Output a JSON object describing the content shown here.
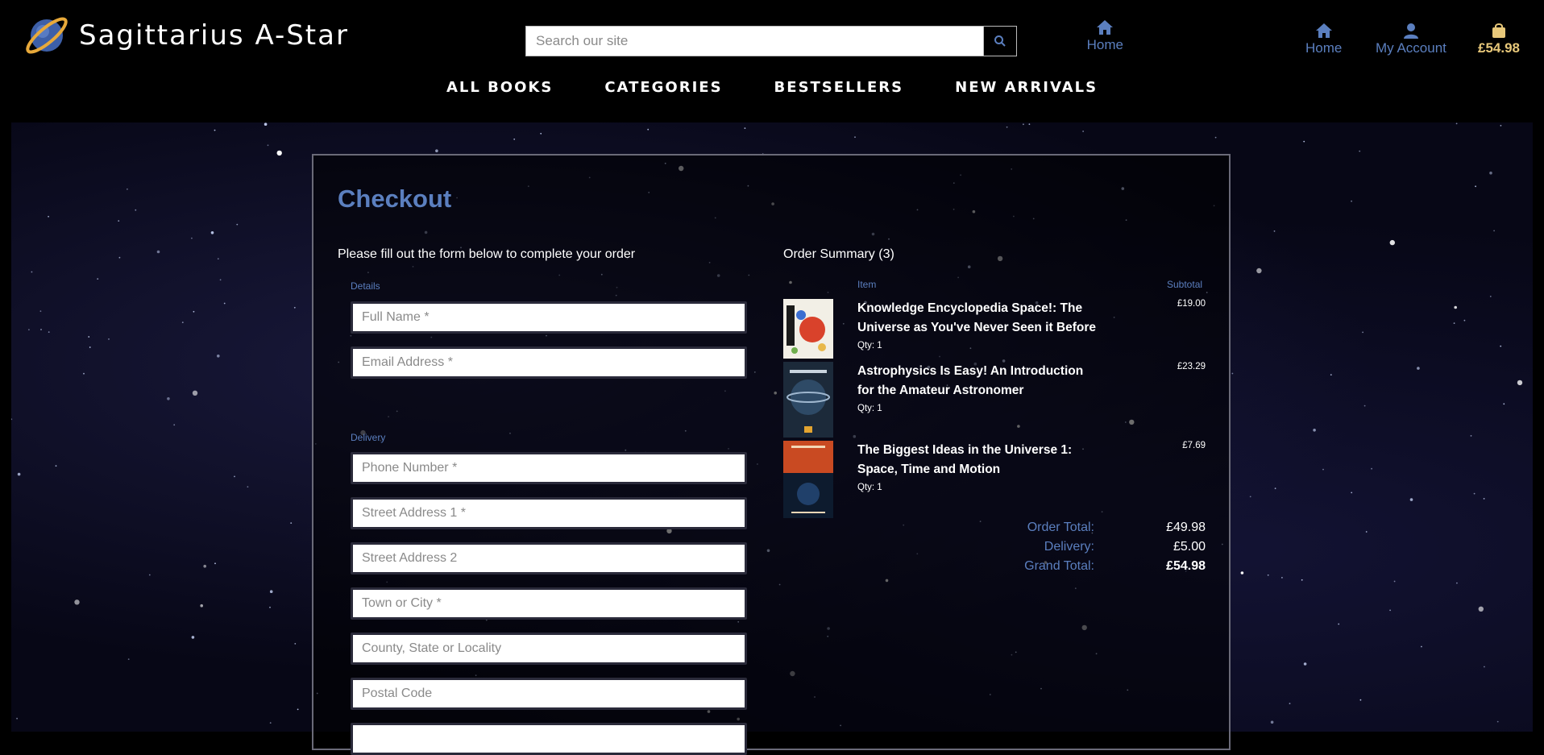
{
  "brand": {
    "name": "Sagittarius A-Star"
  },
  "search": {
    "placeholder": "Search our site",
    "icon": "search-icon"
  },
  "header_nav": {
    "home": "Home",
    "account": "My Account",
    "cart_total": "£54.98"
  },
  "main_nav": [
    "ALL BOOKS",
    "CATEGORIES",
    "BESTSELLERS",
    "NEW ARRIVALS"
  ],
  "checkout": {
    "title": "Checkout",
    "intro": "Please fill out the form below to complete your order",
    "details_label": "Details",
    "delivery_label": "Delivery",
    "details_fields": [
      "Full Name *",
      "Email Address *"
    ],
    "delivery_fields": [
      "Phone Number *",
      "Street Address 1 *",
      "Street Address 2",
      "Town or City *",
      "County, State or Locality",
      "Postal Code"
    ]
  },
  "summary": {
    "title": "Order Summary (3)",
    "col_item": "Item",
    "col_subtotal": "Subtotal",
    "items": [
      {
        "title": "Knowledge Encyclopedia Space!: The Universe as You've Never Seen it Before",
        "qty": "Qty: 1",
        "subtotal": "£19.00"
      },
      {
        "title": "Astrophysics Is Easy! An Introduction for the Amateur Astronomer",
        "qty": "Qty: 1",
        "subtotal": "£23.29"
      },
      {
        "title": "The Biggest Ideas in the Universe 1: Space, Time and Motion",
        "qty": "Qty: 1",
        "subtotal": "£7.69"
      }
    ],
    "order_total_label": "Order Total:",
    "order_total": "£49.98",
    "delivery_label": "Delivery:",
    "delivery": "£5.00",
    "grand_total_label": "Grand Total:",
    "grand_total": "£54.98"
  },
  "colors": {
    "accent": "#5b7fbf",
    "cart": "#e8c87a",
    "background": "#000000"
  }
}
